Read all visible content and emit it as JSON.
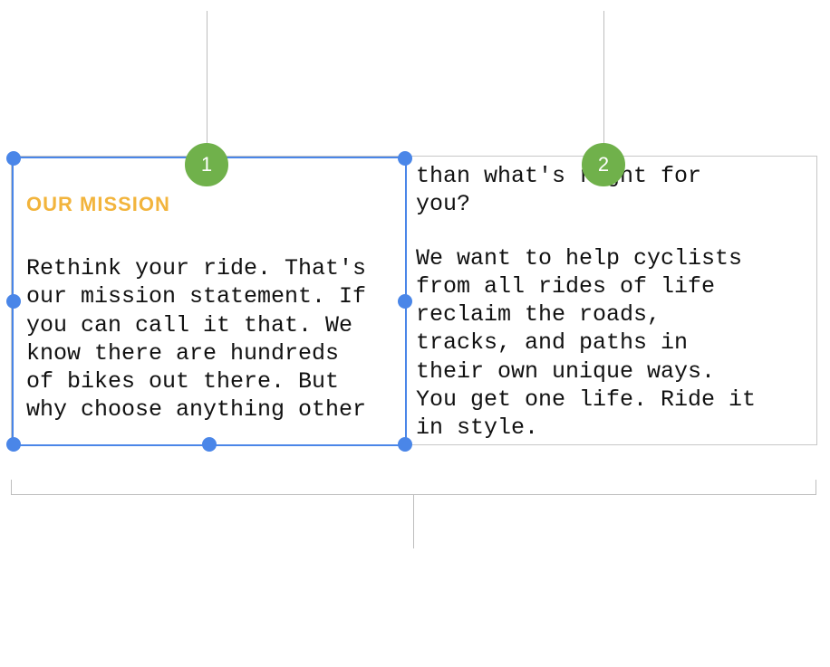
{
  "callouts": {
    "badge1": "1",
    "badge2": "2"
  },
  "textbox_left": {
    "heading": "OUR MISSION",
    "body": "Rethink your ride. That's\nour mission statement. If\nyou can call it that. We\nknow there are hundreds\nof bikes out there. But\nwhy choose anything other"
  },
  "textbox_right": {
    "body_line1": "than what's right for\nyou?",
    "body_para2": "We want to help cyclists\nfrom all rides of life\nreclaim the roads,\ntracks, and paths in\ntheir own unique ways.\nYou get one life. Ride it\nin style."
  },
  "colors": {
    "selection": "#4a86e8",
    "heading": "#f2b43c",
    "badge": "#70b14b",
    "guide": "#bdbdbd"
  }
}
